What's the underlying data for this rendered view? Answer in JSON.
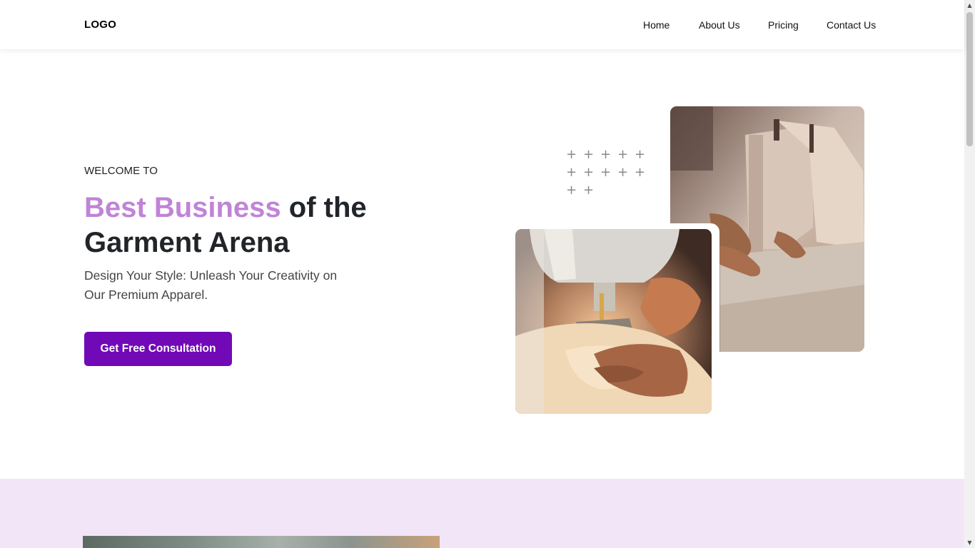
{
  "nav": {
    "logo": "LOGO",
    "links": [
      "Home",
      "About Us",
      "Pricing",
      "Contact Us"
    ]
  },
  "hero": {
    "welcome": "WELCOME TO",
    "headline_accent": "Best Business",
    "headline_rest": " of the Garment Arena",
    "subtext": "Design Your Style: Unleash Your Creativity on Our Premium Apparel.",
    "cta_label": "Get Free Consultation"
  },
  "colors": {
    "accent_text": "#c084d6",
    "cta_background": "#7209b7",
    "lower_section_background": "#f3e5f8"
  },
  "icons": {
    "decor": "plus-pattern-icon",
    "scroll_up": "scroll-up-arrow-icon",
    "scroll_down": "scroll-down-arrow-icon"
  }
}
